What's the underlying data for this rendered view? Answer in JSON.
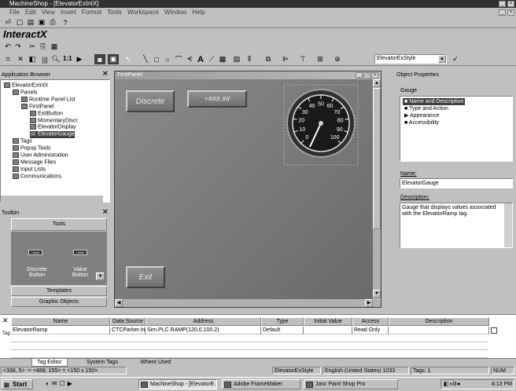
{
  "window": {
    "title": "MachineShop - [ElevatorExIntX]"
  },
  "menu": [
    "File",
    "Edit",
    "View",
    "Insert",
    "Format",
    "Tools",
    "Workspace",
    "Window",
    "Help"
  ],
  "app_brand": "InteractX",
  "toolbar": {
    "zoom": "1:1",
    "style_value": "ElevatorExStyle"
  },
  "app_browser": {
    "title": "Application Browser",
    "items": [
      {
        "label": "ElevatorExIntX",
        "depth": 0
      },
      {
        "label": "Panels",
        "depth": 1
      },
      {
        "label": "Runtime Panel List",
        "depth": 2
      },
      {
        "label": "FirstPanel",
        "depth": 2
      },
      {
        "label": "ExitButton",
        "depth": 3
      },
      {
        "label": "MomentaryDiscr",
        "depth": 3
      },
      {
        "label": "ElevatorDisplay",
        "depth": 3
      },
      {
        "label": "ElevatorGauge",
        "depth": 3
      },
      {
        "label": "Tags",
        "depth": 1
      },
      {
        "label": "Popup Tools",
        "depth": 1
      },
      {
        "label": "User Administration",
        "depth": 1
      },
      {
        "label": "Message Files",
        "depth": 1
      },
      {
        "label": "Input Lists",
        "depth": 1
      },
      {
        "label": "Communications",
        "depth": 1
      }
    ]
  },
  "toolbin": {
    "title": "Toolbin",
    "tools_header": "Tools",
    "label1": "Label",
    "label2": "Label",
    "btn1": "Discrete\nButton",
    "btn2": "Value\nButton",
    "templates": "Templates",
    "graphic_objects": "Graphic Objects"
  },
  "panel": {
    "title": "FirstPanel",
    "discrete": "Discrete",
    "value": "+###.##",
    "exit": "Exit",
    "gauge_ticks": [
      "0",
      "10",
      "20",
      "30",
      "40",
      "50",
      "60",
      "70",
      "80",
      "90",
      "100"
    ]
  },
  "props": {
    "title": "Object Properties",
    "object": "Gauge",
    "list": [
      "Name and Description",
      "Type and Action",
      "Appearance",
      "Accessibility"
    ],
    "name_label": "Name:",
    "name_value": "ElevatorGauge",
    "desc_label": "Description:",
    "desc_value": "Gauge that displays values associated with the ElevatorRamp tag."
  },
  "grid": {
    "headers": [
      "Name",
      "Data Source",
      "Address",
      "Type",
      "Initial Value",
      "Access",
      "Description"
    ],
    "row": [
      "ElevatorRamp",
      "CTCParker.In..",
      "Sim.PLC.RAMP(120,0,100,2)",
      "Default",
      "",
      "Read Only",
      ""
    ]
  },
  "tabs": [
    "Tag Editor",
    "System Tags",
    "Where Used"
  ],
  "side_tab": "Tag",
  "status": {
    "coords": "<338, 5> -> <488, 155> = <150 x 150>",
    "style": "ElevatorExStyle",
    "lang": "English (United States) 1033",
    "tags": "Tags: 1",
    "num": "NUM"
  },
  "taskbar": {
    "start": "Start",
    "tasks": [
      "MachineShop - [ElevatorE...",
      "Adobe FrameMaker",
      "Jasc Paint Shop Pro"
    ],
    "clock": "4:13 PM"
  }
}
